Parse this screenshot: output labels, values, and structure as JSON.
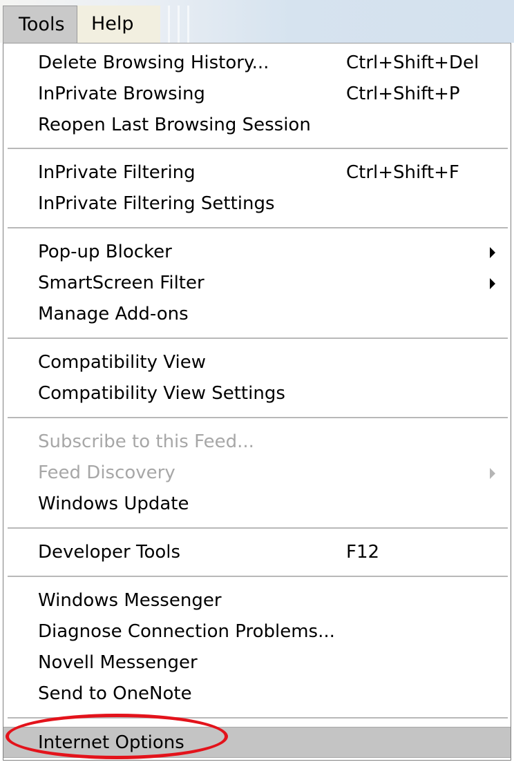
{
  "menubar": {
    "tools_label": "Tools",
    "help_label": "Help"
  },
  "menu": {
    "items": [
      {
        "label": "Delete Browsing History...",
        "shortcut": "Ctrl+Shift+Del"
      },
      {
        "label": "InPrivate Browsing",
        "shortcut": "Ctrl+Shift+P"
      },
      {
        "label": "Reopen Last Browsing Session",
        "shortcut": ""
      },
      {
        "label": "InPrivate Filtering",
        "shortcut": "Ctrl+Shift+F"
      },
      {
        "label": "InPrivate Filtering Settings",
        "shortcut": ""
      },
      {
        "label": "Pop-up Blocker",
        "shortcut": "",
        "submenu": true
      },
      {
        "label": "SmartScreen Filter",
        "shortcut": "",
        "submenu": true
      },
      {
        "label": "Manage Add-ons",
        "shortcut": ""
      },
      {
        "label": "Compatibility View",
        "shortcut": ""
      },
      {
        "label": "Compatibility View Settings",
        "shortcut": ""
      },
      {
        "label": "Subscribe to this Feed...",
        "shortcut": "",
        "disabled": true
      },
      {
        "label": "Feed Discovery",
        "shortcut": "",
        "submenu": true,
        "disabled": true
      },
      {
        "label": "Windows Update",
        "shortcut": ""
      },
      {
        "label": "Developer Tools",
        "shortcut": "F12"
      },
      {
        "label": "Windows Messenger",
        "shortcut": ""
      },
      {
        "label": "Diagnose Connection Problems...",
        "shortcut": ""
      },
      {
        "label": "Novell Messenger",
        "shortcut": ""
      },
      {
        "label": "Send to OneNote",
        "shortcut": ""
      },
      {
        "label": "Internet Options",
        "shortcut": "",
        "highlighted": true
      }
    ]
  },
  "colors": {
    "highlight_background": "#c4c4c4",
    "disabled_text": "#a7a7a7",
    "annotation_circle": "#e3131b"
  }
}
